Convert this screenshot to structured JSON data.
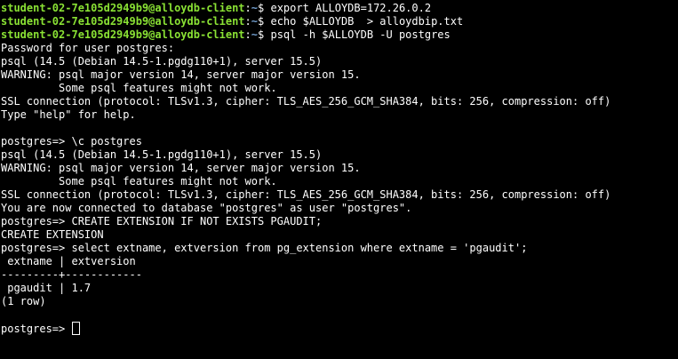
{
  "terminal": {
    "colors": {
      "background": "#000000",
      "text": "#ffffff",
      "prompt_user": "#8ae234",
      "prompt_path": "#729fcf"
    },
    "lines": [
      {
        "type": "shell",
        "user": "student-02-7e105d2949b9@alloydb-client",
        "sep": ":",
        "path": "~",
        "symbol": "$ ",
        "cmd": "export ALLOYDB=172.26.0.2"
      },
      {
        "type": "shell",
        "user": "student-02-7e105d2949b9@alloydb-client",
        "sep": ":",
        "path": "~",
        "symbol": "$ ",
        "cmd": "echo $ALLOYDB  > alloydbip.txt"
      },
      {
        "type": "shell",
        "user": "student-02-7e105d2949b9@alloydb-client",
        "sep": ":",
        "path": "~",
        "symbol": "$ ",
        "cmd": "psql -h $ALLOYDB -U postgres"
      },
      {
        "type": "text",
        "text": "Password for user postgres:"
      },
      {
        "type": "text",
        "text": "psql (14.5 (Debian 14.5-1.pgdg110+1), server 15.5)"
      },
      {
        "type": "text",
        "text": "WARNING: psql major version 14, server major version 15."
      },
      {
        "type": "text",
        "text": "         Some psql features might not work."
      },
      {
        "type": "text",
        "text": "SSL connection (protocol: TLSv1.3, cipher: TLS_AES_256_GCM_SHA384, bits: 256, compression: off)"
      },
      {
        "type": "text",
        "text": "Type \"help\" for help."
      },
      {
        "type": "text",
        "text": ""
      },
      {
        "type": "text",
        "text": "postgres=> \\c postgres"
      },
      {
        "type": "text",
        "text": "psql (14.5 (Debian 14.5-1.pgdg110+1), server 15.5)"
      },
      {
        "type": "text",
        "text": "WARNING: psql major version 14, server major version 15."
      },
      {
        "type": "text",
        "text": "         Some psql features might not work."
      },
      {
        "type": "text",
        "text": "SSL connection (protocol: TLSv1.3, cipher: TLS_AES_256_GCM_SHA384, bits: 256, compression: off)"
      },
      {
        "type": "text",
        "text": "You are now connected to database \"postgres\" as user \"postgres\"."
      },
      {
        "type": "text",
        "text": "postgres=> CREATE EXTENSION IF NOT EXISTS PGAUDIT;"
      },
      {
        "type": "text",
        "text": "CREATE EXTENSION"
      },
      {
        "type": "text",
        "text": "postgres=> select extname, extversion from pg_extension where extname = 'pgaudit';"
      },
      {
        "type": "text",
        "text": " extname | extversion"
      },
      {
        "type": "text",
        "text": "---------+------------"
      },
      {
        "type": "text",
        "text": " pgaudit | 1.7"
      },
      {
        "type": "text",
        "text": "(1 row)"
      },
      {
        "type": "text",
        "text": ""
      },
      {
        "type": "input",
        "text": "postgres=> "
      }
    ]
  }
}
